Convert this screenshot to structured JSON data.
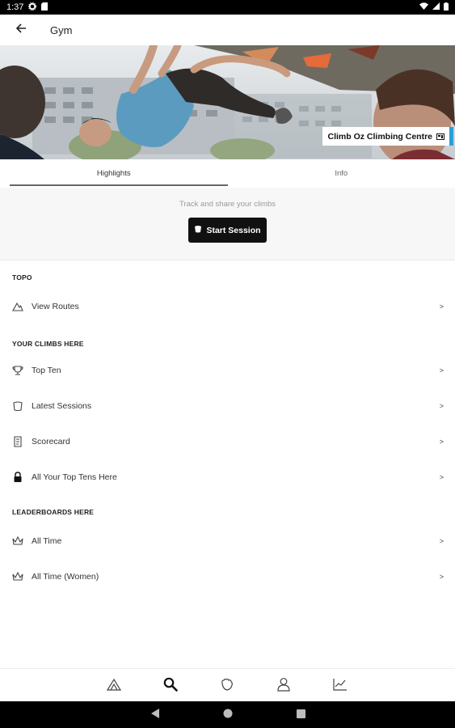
{
  "status_bar": {
    "time": "1:37",
    "icons": [
      "settings-icon",
      "sd-card-icon",
      "wifi-icon",
      "cellular-icon",
      "battery-icon"
    ]
  },
  "app_bar": {
    "title": "Gym",
    "back_icon": "arrow-left-icon"
  },
  "hero": {
    "gym_name": "Climb Oz Climbing Centre",
    "gym_flag_icon": "flag-icon",
    "accent_color": "#2a9fd6"
  },
  "tabs": [
    {
      "label": "Highlights",
      "active": true
    },
    {
      "label": "Info",
      "active": false
    }
  ],
  "session": {
    "prompt": "Track and share your climbs",
    "button_label": "Start Session",
    "button_icon": "chalk-bag-icon"
  },
  "sections": {
    "topo": {
      "header": "TOPO",
      "items": [
        {
          "label": "View Routes",
          "icon": "mountain-icon",
          "chevron": ">"
        }
      ]
    },
    "your_climbs": {
      "header": "YOUR CLIMBS HERE",
      "items": [
        {
          "label": "Top Ten",
          "icon": "trophy-icon",
          "chevron": ">"
        },
        {
          "label": "Latest Sessions",
          "icon": "chalk-bag-icon",
          "chevron": ">"
        },
        {
          "label": "Scorecard",
          "icon": "scorecard-icon",
          "chevron": ">"
        },
        {
          "label": "All Your Top Tens Here",
          "icon": "lock-icon",
          "chevron": ">"
        }
      ]
    },
    "leaderboards": {
      "header": "LEADERBOARDS HERE",
      "items": [
        {
          "label": "All Time",
          "icon": "crown-icon",
          "chevron": ">"
        },
        {
          "label": "All Time (Women)",
          "icon": "crown-icon",
          "chevron": ">"
        }
      ]
    }
  },
  "bottom_nav": {
    "items": [
      "mountain-icon",
      "search-icon",
      "hand-icon",
      "profile-icon",
      "stats-icon"
    ],
    "active": "search-icon"
  },
  "system_nav": [
    "back-triangle-icon",
    "home-circle-icon",
    "recents-square-icon"
  ]
}
